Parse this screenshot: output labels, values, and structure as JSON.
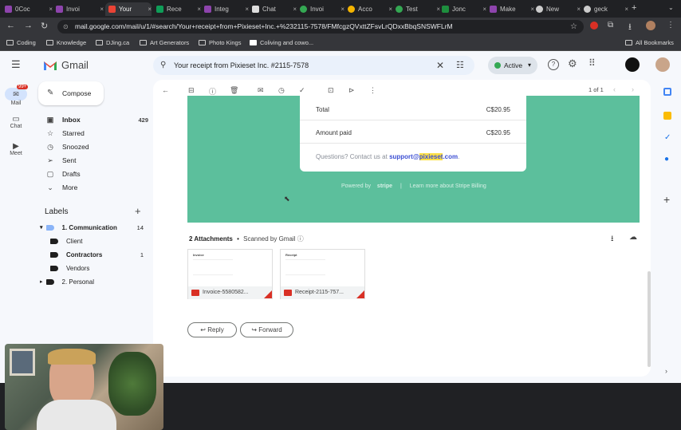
{
  "tabs": [
    "0Coc",
    "Invoi",
    "Your",
    "Rece",
    "Integ",
    "Chat",
    "Invoi",
    "Acco",
    "Test",
    "Jonc",
    "Make",
    "New",
    "geck"
  ],
  "address": "mail.google.com/mail/u/1/#search/Your+receipt+from+Pixieset+Inc.+%232115-7578/FMfcgzQVxttZFsvLrQDxxBbqSNSWFLrM",
  "bookmarks": [
    "Coding",
    "Knowledge",
    "DJing.ca",
    "Art Generators",
    "Photo Kings",
    "Coliving and cowo...",
    "All Bookmarks"
  ],
  "gmail": {
    "app_name": "Gmail",
    "search_value": "Your receipt from Pixieset Inc. #2115-7578",
    "status": "Active",
    "pagination": "1 of 1",
    "rail": {
      "mail": "Mail",
      "badge": "99+",
      "chat": "Chat",
      "meet": "Meet"
    },
    "compose": "Compose",
    "nav": [
      {
        "label": "Inbox",
        "count": "429"
      },
      {
        "label": "Starred",
        "count": ""
      },
      {
        "label": "Snoozed",
        "count": ""
      },
      {
        "label": "Sent",
        "count": ""
      },
      {
        "label": "Drafts",
        "count": ""
      },
      {
        "label": "More",
        "count": ""
      }
    ],
    "labels_title": "Labels",
    "labels": [
      {
        "label": "1. Communication",
        "count": "14"
      },
      {
        "label": "Client",
        "count": ""
      },
      {
        "label": "Contractors",
        "count": "1"
      },
      {
        "label": "Vendors",
        "count": ""
      },
      {
        "label": "2. Personal",
        "count": ""
      }
    ]
  },
  "email": {
    "total_label": "Total",
    "total_value": "C$20.95",
    "paid_label": "Amount paid",
    "paid_value": "C$20.95",
    "question": "Questions? Contact us at ",
    "support_email_pre": "support@",
    "support_email_hl": "pixieset",
    "support_email_post": ".com",
    "support_email_end": ".",
    "powered": "Powered by",
    "stripe": "stripe",
    "learn": "Learn more about Stripe Billing",
    "attachments_count": "2 Attachments",
    "scanned": "Scanned by Gmail",
    "files": [
      {
        "name": "Invoice-5580582...",
        "heading": "Invoice"
      },
      {
        "name": "Receipt-2115-757...",
        "heading": "Receipt"
      }
    ],
    "reply": "Reply",
    "forward": "Forward"
  },
  "colors": {
    "brand_green": "#5cbf9c",
    "link": "#3c4fd3",
    "highlight": "#fde047"
  }
}
